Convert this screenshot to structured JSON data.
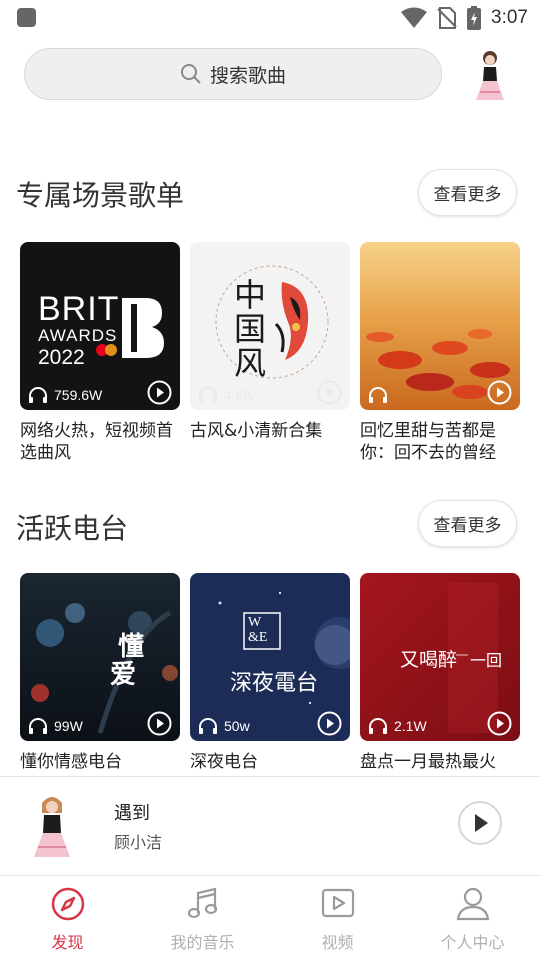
{
  "status": {
    "time": "3:07"
  },
  "search": {
    "placeholder": "搜索歌曲"
  },
  "sections": [
    {
      "title": "专属场景歌单",
      "more": "查看更多",
      "cards": [
        {
          "count": "759.6W",
          "title": "网络火热，短视频首选曲风",
          "cover_text": [
            "BRIT",
            "AWARDS",
            "2022"
          ]
        },
        {
          "count": "4.6K",
          "title": "古风&小清新合集",
          "cover_text": [
            "中国风"
          ]
        },
        {
          "count": "",
          "title": "回忆里甜与苦都是你：回不去的曾经"
        }
      ]
    },
    {
      "title": "活跃电台",
      "more": "查看更多",
      "cards": [
        {
          "count": "99W",
          "title": "懂你情感电台",
          "cover_text": [
            "懂",
            "爱"
          ]
        },
        {
          "count": "50w",
          "title": "深夜电台",
          "cover_text": [
            "W",
            "&E",
            "深夜電台"
          ]
        },
        {
          "count": "2.1W",
          "title": "盘点一月最热最火",
          "cover_text": [
            "又喝醉",
            "一回"
          ]
        }
      ]
    }
  ],
  "player": {
    "title": "遇到",
    "artist": "顾小洁"
  },
  "nav": [
    {
      "label": "发现",
      "icon": "compass-icon",
      "active": true
    },
    {
      "label": "我的音乐",
      "icon": "music-note-icon",
      "active": false
    },
    {
      "label": "视频",
      "icon": "video-icon",
      "active": false
    },
    {
      "label": "个人中心",
      "icon": "user-icon",
      "active": false
    }
  ],
  "colors": {
    "accent": "#d9364a",
    "inactive": "#b0b0b0"
  }
}
